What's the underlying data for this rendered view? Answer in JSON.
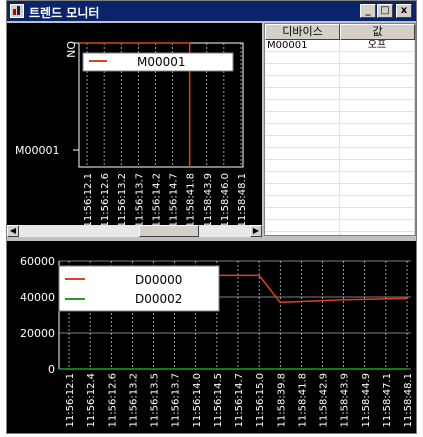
{
  "window": {
    "title": "트렌드 모니터",
    "minimize_label": "_",
    "maximize_label": "□",
    "close_label": "x"
  },
  "bit_trend": {
    "ytick_top": "ON",
    "ytick_bottom": "M00001",
    "legend": [
      {
        "name": "M00001",
        "color": "#e04020"
      }
    ],
    "x_labels": [
      "11:56:12.1",
      "11:56:12.6",
      "11:56:13.2",
      "11:56:13.7",
      "11:56:14.2",
      "11:56:14.7",
      "11:58:41.8",
      "11:58:43.9",
      "11:58:46.0",
      "11:58:48.1"
    ]
  },
  "device_table": {
    "columns": [
      "디바이스",
      "값"
    ],
    "rows": [
      {
        "device": "M00001",
        "value": "오프"
      }
    ]
  },
  "hscroll": {
    "left_arrow": "◀",
    "right_arrow": "▶"
  },
  "chart_data": {
    "type": "line",
    "ytick_labels": [
      "60000",
      "40000",
      "20000",
      "0"
    ],
    "ylim": [
      0,
      60000
    ],
    "x": [
      "11:56:12.1",
      "11:56:12.4",
      "11:56:12.6",
      "11:56:13.2",
      "11:56:13.5",
      "11:56:13.7",
      "11:56:14.0",
      "11:56:14.5",
      "11:56:14.7",
      "11:56:15.0",
      "11:58:39.8",
      "11:58:41.8",
      "11:58:42.9",
      "11:58:43.9",
      "11:58:44.9",
      "11:58:47.1",
      "11:58:48.1"
    ],
    "series": [
      {
        "name": "D00000",
        "color": "#e04020",
        "values": [
          52000,
          52000,
          52000,
          52000,
          52000,
          52000,
          52000,
          52000,
          52000,
          52000,
          37000,
          37500,
          38000,
          38500,
          38700,
          39000,
          39200
        ]
      },
      {
        "name": "D00002",
        "color": "#20a020",
        "values": [
          0,
          0,
          0,
          0,
          0,
          0,
          0,
          0,
          0,
          0,
          0,
          0,
          0,
          0,
          0,
          0,
          0
        ]
      }
    ]
  }
}
